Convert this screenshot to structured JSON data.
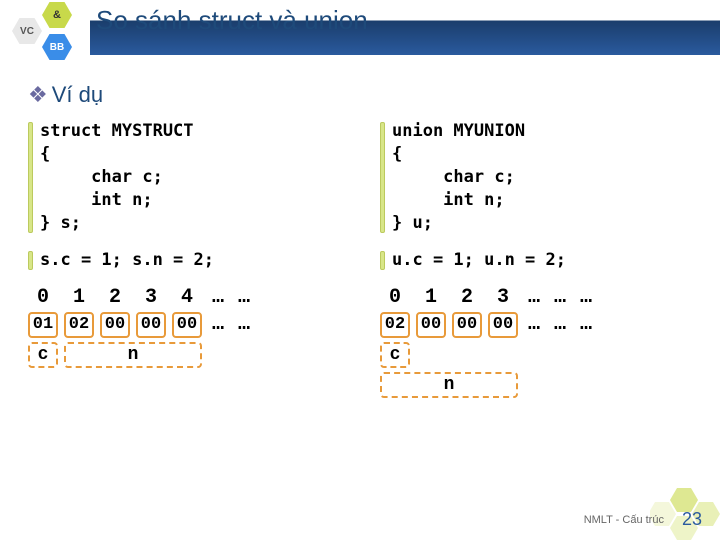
{
  "logo": {
    "amp": "&",
    "vc": "VC",
    "bb": "BB"
  },
  "title": "So sánh struct và union",
  "section": {
    "bullet": "❖",
    "text": "Ví dụ"
  },
  "left": {
    "code1": "struct MYSTRUCT\n{\n     char c;\n     int n;\n} s;",
    "code2": "s.c = 1; s.n = 2;",
    "indices": [
      "0",
      "1",
      "2",
      "3",
      "4",
      "…",
      "…"
    ],
    "cells": [
      "01",
      "02",
      "00",
      "00",
      "00"
    ],
    "trail": [
      "…",
      "…"
    ],
    "label_c": "c",
    "label_n": "n"
  },
  "right": {
    "code1": "union MYUNION\n{\n     char c;\n     int n;\n} u;",
    "code2": "u.c = 1; u.n = 2;",
    "indices": [
      "0",
      "1",
      "2",
      "3",
      "…",
      "…",
      "…"
    ],
    "cells": [
      "02",
      "00",
      "00",
      "00"
    ],
    "trail": [
      "…",
      "…",
      "…"
    ],
    "label_c": "c",
    "label_n": "n"
  },
  "footer": {
    "text": "NMLT - Cấu trúc",
    "page": "23"
  }
}
